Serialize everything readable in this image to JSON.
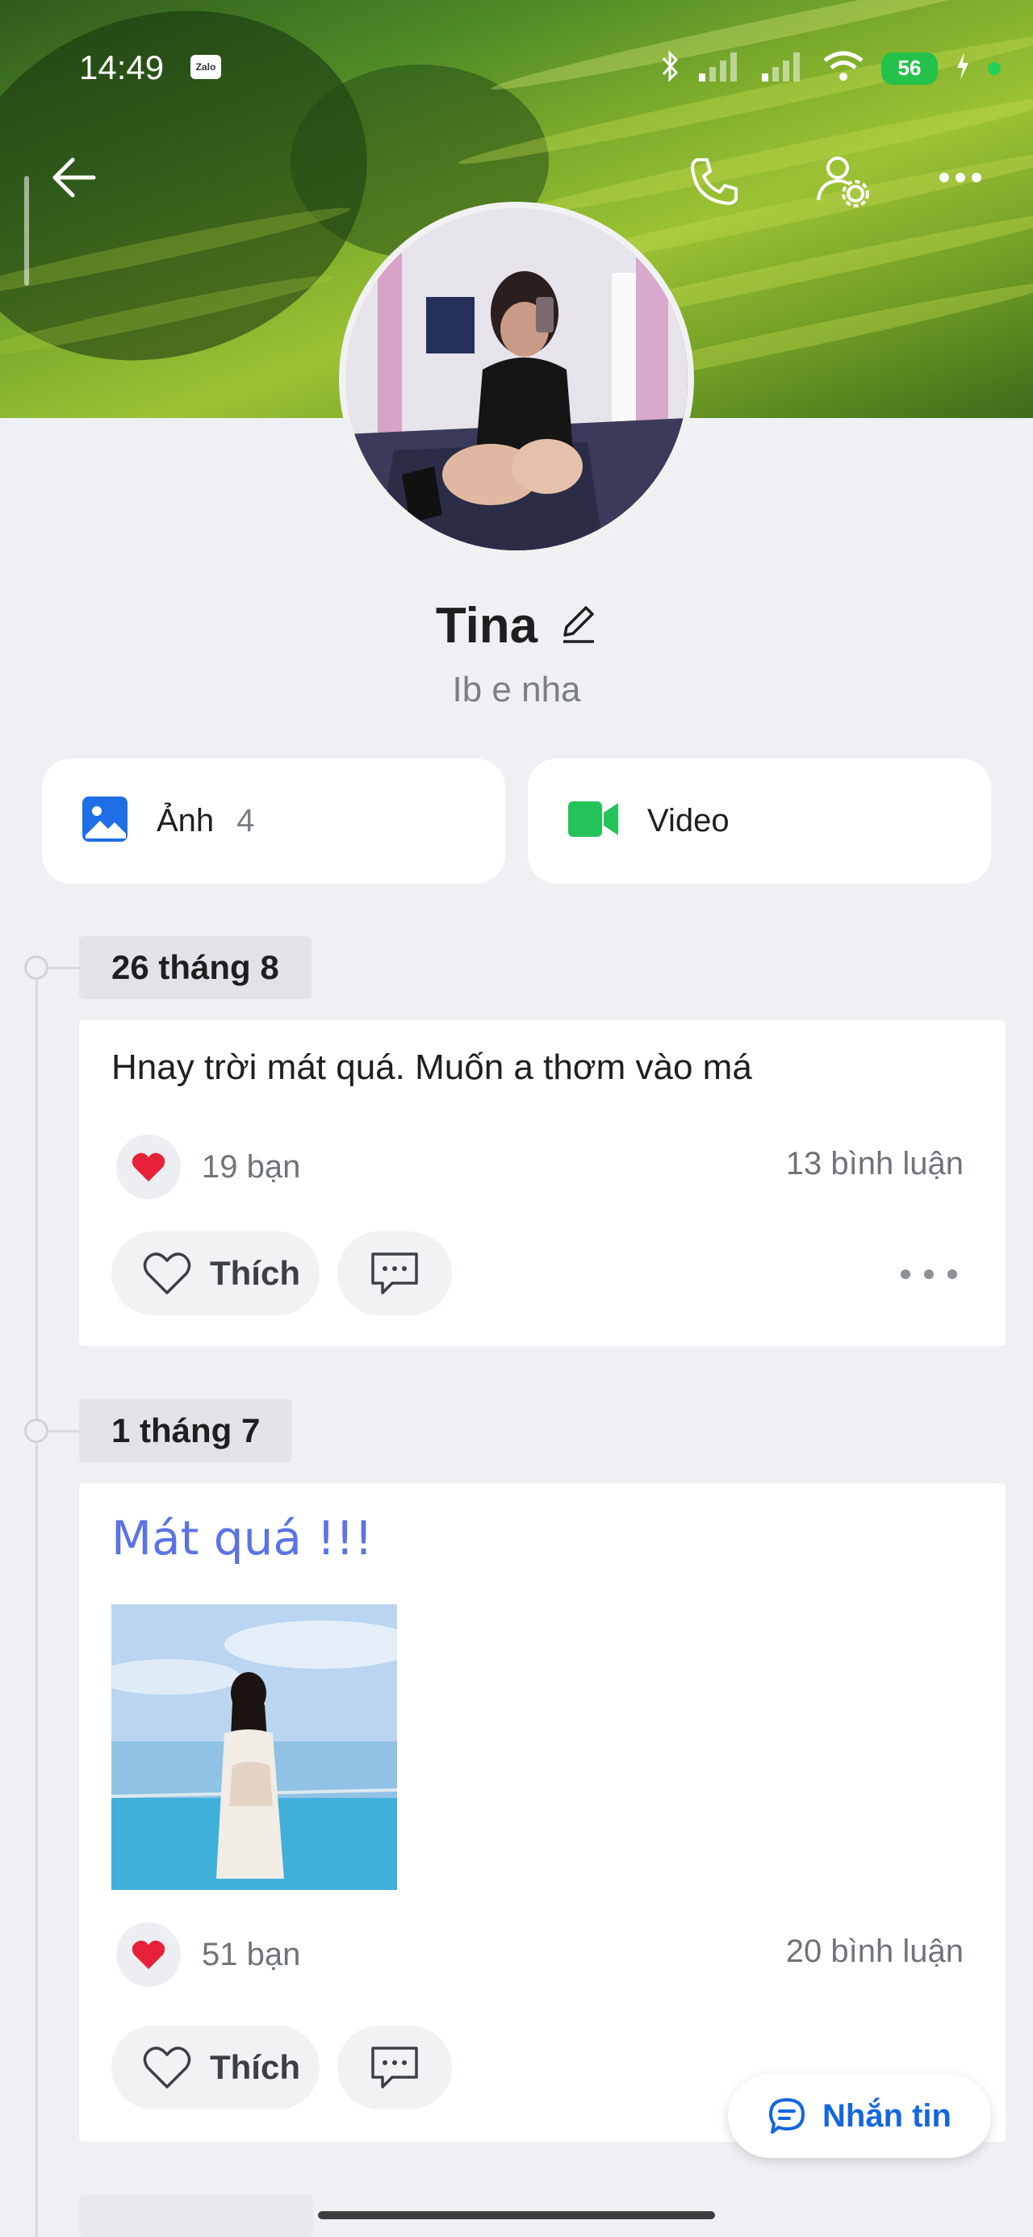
{
  "status_bar": {
    "time": "14:49",
    "notification_app": "Zalo",
    "battery": "56"
  },
  "profile": {
    "name": "Tina",
    "status": "Ib e nha"
  },
  "media": {
    "photos_label": "Ảnh",
    "photos_count": "4",
    "video_label": "Video"
  },
  "posts": [
    {
      "date": "26 tháng 8",
      "text": "Hnay trời mát quá. Muốn a thơm vào má",
      "reactions": "19 bạn",
      "comments": "13 bình luận",
      "like_label": "Thích"
    },
    {
      "date": "1 tháng 7",
      "title": "Mát quá !!!",
      "reactions": "51 bạn",
      "comments": "20 bình luận",
      "like_label": "Thích"
    }
  ],
  "fab": {
    "label": "Nhắn tin"
  },
  "colors": {
    "accent_blue": "#1466e0",
    "title_blue": "#5b73e6",
    "photo_icon": "#1e6fe6",
    "video_icon": "#24c35a",
    "heart": "#e8213a"
  },
  "icons": {
    "back": "arrow-left-icon",
    "call": "phone-icon",
    "settings": "user-gear-icon",
    "more": "more-horizontal-icon",
    "edit": "pencil-icon",
    "photo": "image-icon",
    "video": "video-camera-icon",
    "heart": "heart-icon",
    "like": "heart-outline-icon",
    "comment": "chat-bubble-icon",
    "message": "message-icon"
  }
}
